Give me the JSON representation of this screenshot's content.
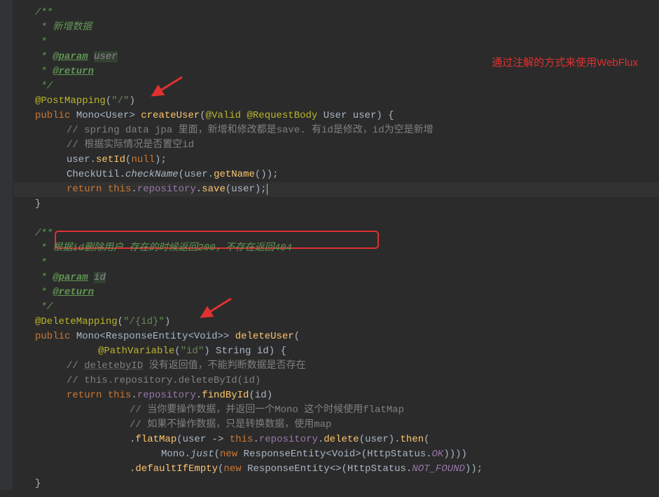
{
  "annotation": "通过注解的方式来使用WebFlux",
  "block1": {
    "doc_open": "/**",
    "doc_line1": " * 新增数据",
    "doc_empty": " *",
    "doc_param_prefix": " * ",
    "doc_param_tag": "@param",
    "doc_param_name": "user",
    "doc_return_tag": "@return",
    "doc_close": " */",
    "anno": "@PostMapping",
    "anno_arg": "\"/\"",
    "sig_public": "public ",
    "sig_mono": "Mono",
    "sig_user": "User",
    "sig_method": "createUser",
    "sig_valid": "@Valid",
    "sig_reqbody": "@RequestBody",
    "sig_type": "User",
    "sig_param": "user",
    "comment1": "// spring data jpa 里面，新增和修改都是save. 有id是修改，id为空是新增",
    "comment2": "// 根据实际情况是否置空id",
    "stmt1_obj": "user",
    "stmt1_method": "setId",
    "stmt1_arg": "null",
    "stmt2_obj": "CheckUtil",
    "stmt2_method": "checkName",
    "stmt2_arg_obj": "user",
    "stmt2_arg_method": "getName",
    "return_kw": "return ",
    "return_this": "this",
    "return_field": "repository",
    "return_method": "save",
    "return_arg": "user"
  },
  "block2": {
    "doc_open": "/**",
    "doc_line1": " * 根据id删除用户 存在的时候返回200，不存在返回404",
    "doc_empty": " * ",
    "doc_param_tag": "@param",
    "doc_param_name": "id",
    "doc_return_tag": "@return",
    "doc_close": " */",
    "anno": "@DeleteMapping",
    "anno_arg": "\"/{id}\"",
    "sig_public": "public ",
    "sig_mono": "Mono",
    "sig_re": "ResponseEntity",
    "sig_void": "Void",
    "sig_method": "deleteUser",
    "sig_pathvar": "@PathVariable",
    "sig_pathvar_arg": "\"id\"",
    "sig_type": "String",
    "sig_param": "id",
    "comment1a": "// ",
    "comment1b": "deletebyID",
    "comment1c": " 没有返回值，不能判断数据是否存在",
    "comment2": "// this.repository.deleteById(id)",
    "return_kw": "return ",
    "return_this": "this",
    "return_field": "repository",
    "return_method": "findById",
    "return_arg": "id",
    "comment3": "// 当你要操作数据，并返回一个Mono 这个时候使用flatMap",
    "comment4": "// 如果不操作数据，只是转换数据，使用map",
    "flatmap": "flatMap",
    "fm_param": "user",
    "fm_this": "this",
    "fm_field": "repository",
    "fm_method": "delete",
    "fm_arg": "user",
    "fm_then": "then",
    "mono_just_cls": "Mono",
    "mono_just": "just",
    "new_kw": "new",
    "re_cls": "ResponseEntity",
    "void_cls": "Void",
    "http_cls": "HttpStatus",
    "ok_const": "OK",
    "default_method": "defaultIfEmpty",
    "nf_const": "NOT_FOUND"
  }
}
